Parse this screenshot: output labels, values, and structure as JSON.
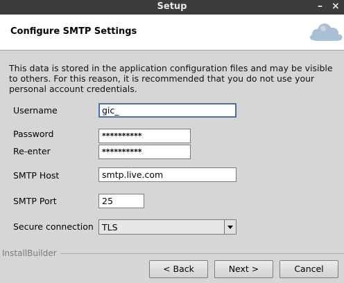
{
  "window": {
    "title": "Setup",
    "minimize_glyph": "–",
    "close_glyph": "×"
  },
  "header": {
    "title": "Configure SMTP Settings",
    "logo_icon": "owncloud-cloud-logo"
  },
  "description": "This data is stored in the application configuration files and may be visible to others. For this reason, it is recommended that you do not use your personal account credentials.",
  "form": {
    "username": {
      "label": "Username",
      "value": "gic_"
    },
    "password": {
      "label": "Password",
      "value": "**********"
    },
    "reenter": {
      "label": "Re-enter",
      "value": "**********"
    },
    "smtp_host": {
      "label": "SMTP Host",
      "value": "smtp.live.com"
    },
    "smtp_port": {
      "label": "SMTP Port",
      "value": "25"
    },
    "secure_connection": {
      "label": "Secure connection",
      "value": "TLS"
    }
  },
  "footer": {
    "brand": "InstallBuilder",
    "back_label": "< Back",
    "next_label": "Next >",
    "cancel_label": "Cancel"
  },
  "colors": {
    "titlebar": "#3c3c3c",
    "dialog_bg": "#d6d6d6",
    "focus_border": "#4a6fa5",
    "logo": "#a9bfd4"
  }
}
